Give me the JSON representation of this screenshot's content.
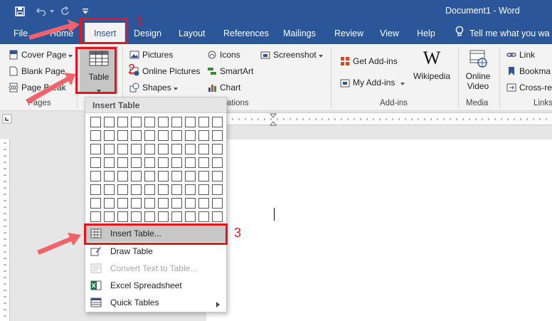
{
  "title_bar": {
    "document_title": "Document1 - Word"
  },
  "tabs": [
    {
      "label": "File"
    },
    {
      "label": "Home"
    },
    {
      "label": "Insert",
      "active": true
    },
    {
      "label": "Design"
    },
    {
      "label": "Layout"
    },
    {
      "label": "References"
    },
    {
      "label": "Mailings"
    },
    {
      "label": "Review"
    },
    {
      "label": "View"
    },
    {
      "label": "Help"
    }
  ],
  "tell_me": "Tell me what you wa",
  "ribbon": {
    "pages": {
      "cover_page": "Cover Page",
      "blank_page": "Blank Page",
      "page_break": "Page Break",
      "group_label": "Pages"
    },
    "table": {
      "label": "Table"
    },
    "illustrations": {
      "pictures": "Pictures",
      "online_pictures": "Online Pictures",
      "shapes": "Shapes",
      "icons": "Icons",
      "smartart": "SmartArt",
      "chart": "Chart",
      "screenshot": "Screenshot",
      "group_label": "ations"
    },
    "addins": {
      "get_addins": "Get Add-ins",
      "my_addins": "My Add-ins",
      "wikipedia": "Wikipedia",
      "group_label": "Add-ins"
    },
    "media": {
      "online_video_line1": "Online",
      "online_video_line2": "Video",
      "group_label": "Media"
    },
    "links": {
      "link": "Link",
      "bookmark": "Bookma",
      "cross_ref": "Cross-ref",
      "group_label": "Links"
    }
  },
  "dropdown": {
    "header": "Insert Table",
    "items": [
      {
        "label": "Insert Table..."
      },
      {
        "label": "Draw Table"
      },
      {
        "label": "Convert Text to Table..."
      },
      {
        "label": "Excel Spreadsheet"
      },
      {
        "label": "Quick Tables"
      }
    ]
  },
  "annotations": {
    "step1": "1",
    "step2": "2",
    "step3": "3"
  },
  "colors": {
    "word_blue": "#2b579a",
    "annotation_red": "#e0171f",
    "arrow_salmon": "#f0636b"
  }
}
